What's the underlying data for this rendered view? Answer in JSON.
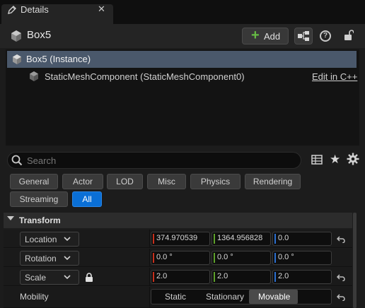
{
  "tab": {
    "label": "Details",
    "close": "✕"
  },
  "header": {
    "title": "Box5",
    "add_label": "Add"
  },
  "tree": {
    "instance_label": "Box5 (Instance)",
    "component_label": "StaticMeshComponent (StaticMeshComponent0)",
    "edit_link": "Edit in C++"
  },
  "search": {
    "placeholder": "Search",
    "value": ""
  },
  "filters": {
    "general": "General",
    "actor": "Actor",
    "lod": "LOD",
    "misc": "Misc",
    "physics": "Physics",
    "rendering": "Rendering",
    "streaming": "Streaming",
    "all": "All",
    "active": "All"
  },
  "transform": {
    "category": "Transform",
    "location": {
      "label": "Location",
      "x": "374.970539",
      "y": "1364.956828",
      "z": "0.0"
    },
    "rotation": {
      "label": "Rotation",
      "x": "0.0 °",
      "y": "0.0 °",
      "z": "0.0 °"
    },
    "scale": {
      "label": "Scale",
      "x": "2.0",
      "y": "2.0",
      "z": "2.0"
    },
    "mobility": {
      "label": "Mobility",
      "options": [
        "Static",
        "Stationary",
        "Movable"
      ],
      "selected": "Movable"
    }
  },
  "colors": {
    "accent": "#0a6fd6",
    "selection": "#4a586b",
    "axis_x": "#c8301c",
    "axis_y": "#5ea12a",
    "axis_z": "#2a6fd0",
    "add_plus": "#66bb44"
  }
}
